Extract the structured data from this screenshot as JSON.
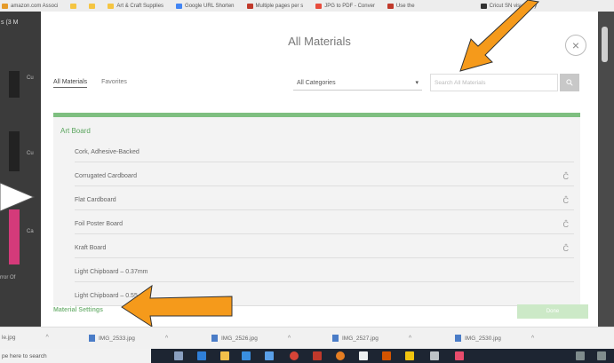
{
  "bookmarks": [
    {
      "label": "amazon.com Associ",
      "color": "#e59b2a"
    },
    {
      "label": "",
      "color": "#f5c542"
    },
    {
      "label": "",
      "color": "#f5c542"
    },
    {
      "label": "Art & Craft Supplies",
      "color": "#f5c542"
    },
    {
      "label": "Google URL Shorten",
      "color": "#4285f4"
    },
    {
      "label": "Multiple pages per s",
      "color": "#c0392b"
    },
    {
      "label": "JPG to PDF - Conver",
      "color": "#e74c3c"
    },
    {
      "label": "Use the",
      "color": "#c0392b"
    },
    {
      "label": "Cricut SN visual key",
      "color": "#333333"
    }
  ],
  "left_panel": {
    "top_label": "s (3 M",
    "items": [
      "Cu",
      "Cu",
      "Ca",
      "rror Of"
    ]
  },
  "modal": {
    "title": "All Materials",
    "close_symbol": "×",
    "tabs": [
      "All Materials",
      "Favorites"
    ],
    "category_select": {
      "value": "All Categories",
      "arrow": "▾"
    },
    "search": {
      "placeholder": "Search All Materials",
      "button_icon": "search-icon"
    },
    "group": "Art Board",
    "items": [
      {
        "label": "Cork, Adhesive-Backed",
        "cut_icon": ""
      },
      {
        "label": "Corrugated Cardboard",
        "cut_icon": "Ĉ"
      },
      {
        "label": "Flat Cardboard",
        "cut_icon": "Ĉ"
      },
      {
        "label": "Foil Poster Board",
        "cut_icon": "Ĉ"
      },
      {
        "label": "Kraft Board",
        "cut_icon": "Ĉ"
      },
      {
        "label": "Light Chipboard – 0.37mm",
        "cut_icon": ""
      },
      {
        "label": "Light Chipboard – 0.55 mm",
        "cut_icon": ""
      }
    ],
    "footer_link": "Material Settings",
    "footer_button": "Done"
  },
  "downloads": [
    {
      "name": "le.jpg"
    },
    {
      "name": "IMG_2533.jpg"
    },
    {
      "name": "IMG_2526.jpg"
    },
    {
      "name": "IMG_2527.jpg"
    },
    {
      "name": "IMG_2530.jpg"
    }
  ],
  "taskbar": {
    "search_placeholder": "pe here to search"
  },
  "colors": {
    "accent_green": "#7ebf80",
    "arrow_orange": "#f59a1b"
  }
}
